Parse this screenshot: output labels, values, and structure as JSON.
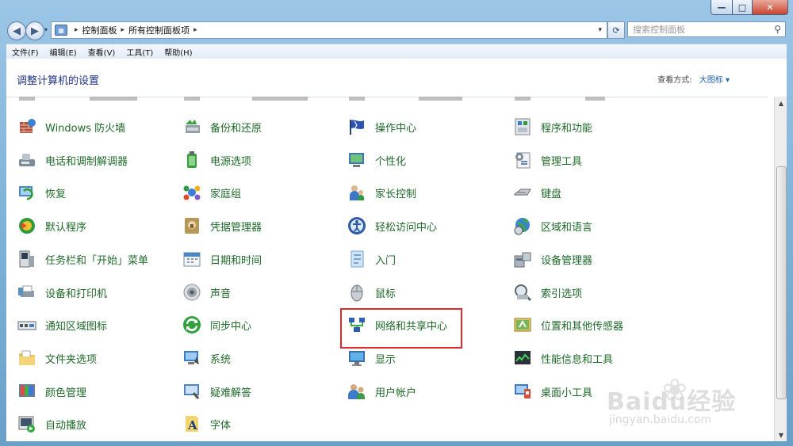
{
  "window": {
    "controls": {
      "minimize": "—",
      "maximize": "□",
      "close": "✕"
    }
  },
  "nav": {
    "back": "◀",
    "forward": "▶",
    "breadcrumb": [
      "控制面板",
      "所有控制面板项"
    ],
    "search_placeholder": "搜索控制面板"
  },
  "menu": [
    "文件(F)",
    "编辑(E)",
    "查看(V)",
    "工具(T)",
    "帮助(H)"
  ],
  "header": {
    "title": "调整计算机的设置",
    "view_by_label": "查看方式:",
    "view_by_value": "大图标 ▾"
  },
  "items": [
    [
      {
        "label": "Windows 防火墙",
        "icon": "firewall-icon"
      },
      {
        "label": "电话和调制解调器",
        "icon": "phone-modem-icon"
      },
      {
        "label": "恢复",
        "icon": "recovery-icon"
      },
      {
        "label": "默认程序",
        "icon": "default-programs-icon"
      },
      {
        "label": "任务栏和「开始」菜单",
        "icon": "taskbar-icon"
      },
      {
        "label": "设备和打印机",
        "icon": "printer-icon"
      },
      {
        "label": "通知区域图标",
        "icon": "notification-area-icon"
      },
      {
        "label": "文件夹选项",
        "icon": "folder-options-icon"
      },
      {
        "label": "颜色管理",
        "icon": "color-management-icon"
      },
      {
        "label": "自动播放",
        "icon": "autoplay-icon"
      }
    ],
    [
      {
        "label": "备份和还原",
        "icon": "backup-icon"
      },
      {
        "label": "电源选项",
        "icon": "power-icon"
      },
      {
        "label": "家庭组",
        "icon": "homegroup-icon"
      },
      {
        "label": "凭据管理器",
        "icon": "credential-icon"
      },
      {
        "label": "日期和时间",
        "icon": "calendar-icon"
      },
      {
        "label": "声音",
        "icon": "sound-icon"
      },
      {
        "label": "同步中心",
        "icon": "sync-icon"
      },
      {
        "label": "系统",
        "icon": "system-icon"
      },
      {
        "label": "疑难解答",
        "icon": "troubleshoot-icon"
      },
      {
        "label": "字体",
        "icon": "fonts-icon"
      }
    ],
    [
      {
        "label": "操作中心",
        "icon": "flag-icon"
      },
      {
        "label": "个性化",
        "icon": "personalization-icon"
      },
      {
        "label": "家长控制",
        "icon": "parental-controls-icon"
      },
      {
        "label": "轻松访问中心",
        "icon": "ease-of-access-icon"
      },
      {
        "label": "入门",
        "icon": "getting-started-icon"
      },
      {
        "label": "鼠标",
        "icon": "mouse-icon"
      },
      {
        "label": "网络和共享中心",
        "icon": "network-icon"
      },
      {
        "label": "显示",
        "icon": "display-icon"
      },
      {
        "label": "用户帐户",
        "icon": "user-accounts-icon"
      }
    ],
    [
      {
        "label": "程序和功能",
        "icon": "programs-icon"
      },
      {
        "label": "管理工具",
        "icon": "admin-tools-icon"
      },
      {
        "label": "键盘",
        "icon": "keyboard-icon"
      },
      {
        "label": "区域和语言",
        "icon": "globe-icon"
      },
      {
        "label": "设备管理器",
        "icon": "device-manager-icon"
      },
      {
        "label": "索引选项",
        "icon": "indexing-icon"
      },
      {
        "label": "位置和其他传感器",
        "icon": "location-sensor-icon"
      },
      {
        "label": "性能信息和工具",
        "icon": "performance-icon"
      },
      {
        "label": "桌面小工具",
        "icon": "gadgets-icon"
      }
    ]
  ],
  "highlighted_item": "网络和共享中心",
  "watermark": {
    "brand": "Baidu经验",
    "url": "jingyan.baidu.com"
  }
}
